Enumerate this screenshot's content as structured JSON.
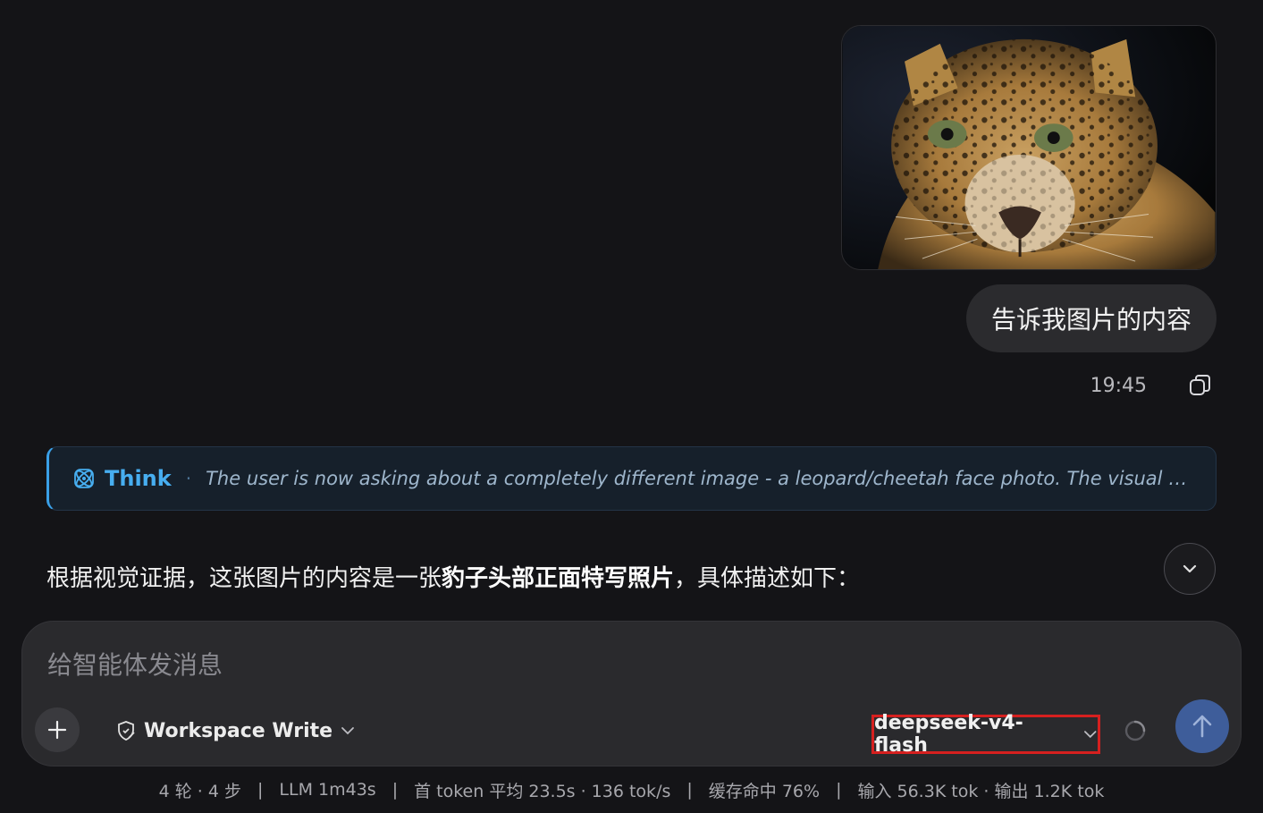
{
  "user_message": {
    "image_alt": "leopard face close-up",
    "text": "告诉我图片的内容",
    "time": "19:45",
    "copy_icon": "copy-icon"
  },
  "think": {
    "label": "Think",
    "dot": "·",
    "text": "The user is now asking about a completely different image - a leopard/cheetah face photo. The visual evidence de...",
    "icon": "atom-icon",
    "accent_color": "#47aef0"
  },
  "answer": {
    "prefix": "根据视觉证据，这张图片的内容是一张",
    "bold": "豹子头部正面特写照片",
    "suffix": "，具体描述如下："
  },
  "composer": {
    "placeholder": "给智能体发消息",
    "value": "",
    "mode_label": "Workspace Write",
    "model_label": "deepseek-v4-flash",
    "send_color": "#3e5d9a",
    "highlight_color": "#d6201f"
  },
  "status": {
    "rounds": "4 轮 · 4 步",
    "llm": "LLM 1m43s",
    "first_token": "首 token 平均 23.5s · 136 tok/s",
    "cache": "缓存命中 76%",
    "io": "输入 56.3K tok · 输出 1.2K tok",
    "sep": "|"
  }
}
